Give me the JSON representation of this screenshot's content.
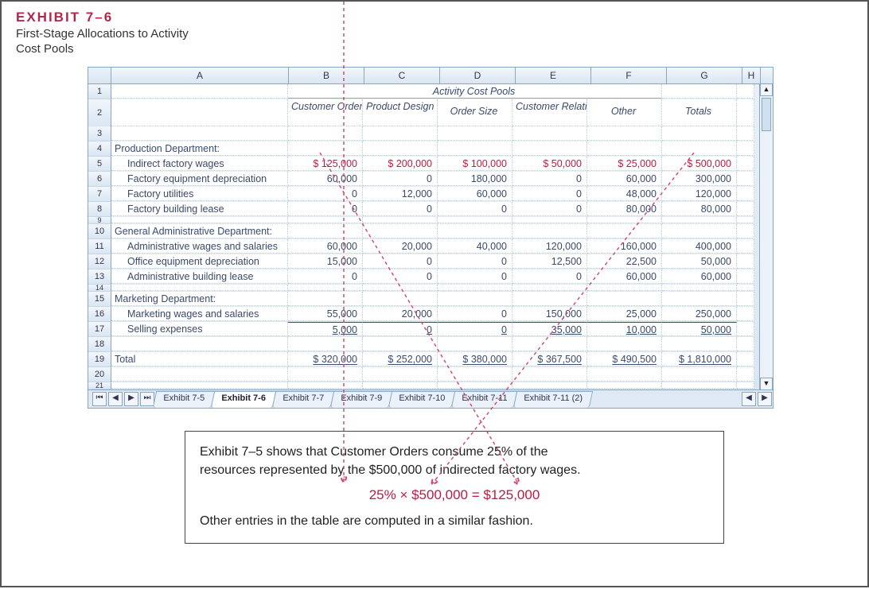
{
  "exhibit": {
    "number": "EXHIBIT 7–6",
    "title_line1": "First-Stage Allocations to Activity",
    "title_line2": "Cost Pools"
  },
  "columns": {
    "A": "A",
    "B": "B",
    "C": "C",
    "D": "D",
    "E": "E",
    "F": "F",
    "G": "G",
    "H": "H"
  },
  "header_row1_title": "Activity Cost Pools",
  "header_row2": {
    "B": "Customer Orders",
    "C": "Product Design",
    "D": "Order Size",
    "E": "Customer Relations",
    "F": "Other",
    "G": "Totals"
  },
  "sections": {
    "prod": "Production Department:",
    "admin": "General Administrative Department:",
    "mkt": "Marketing Department:",
    "total": "Total"
  },
  "rows": {
    "r5": {
      "label": "Indirect factory wages",
      "B": "$ 125,000",
      "C": "$ 200,000",
      "D": "$ 100,000",
      "E": "$   50,000",
      "F": "$   25,000",
      "G": "$    500,000"
    },
    "r6": {
      "label": "Factory equipment depreciation",
      "B": "60,000",
      "C": "0",
      "D": "180,000",
      "E": "0",
      "F": "60,000",
      "G": "300,000"
    },
    "r7": {
      "label": "Factory utilities",
      "B": "0",
      "C": "12,000",
      "D": "60,000",
      "E": "0",
      "F": "48,000",
      "G": "120,000"
    },
    "r8": {
      "label": "Factory building lease",
      "B": "0",
      "C": "0",
      "D": "0",
      "E": "0",
      "F": "80,000",
      "G": "80,000"
    },
    "r11": {
      "label": "Administrative wages and salaries",
      "B": "60,000",
      "C": "20,000",
      "D": "40,000",
      "E": "120,000",
      "F": "160,000",
      "G": "400,000"
    },
    "r12": {
      "label": "Office equipment depreciation",
      "B": "15,000",
      "C": "0",
      "D": "0",
      "E": "12,500",
      "F": "22,500",
      "G": "50,000"
    },
    "r13": {
      "label": "Administrative building lease",
      "B": "0",
      "C": "0",
      "D": "0",
      "E": "0",
      "F": "60,000",
      "G": "60,000"
    },
    "r16": {
      "label": "Marketing wages and salaries",
      "B": "55,000",
      "C": "20,000",
      "D": "0",
      "E": "150,000",
      "F": "25,000",
      "G": "250,000"
    },
    "r17": {
      "label": "Selling expenses",
      "B": "5,000",
      "C": "0",
      "D": "0",
      "E": "35,000",
      "F": "10,000",
      "G": "50,000"
    },
    "r19": {
      "B": "$ 320,000",
      "C": "$ 252,000",
      "D": "$ 380,000",
      "E": "$ 367,500",
      "F": "$ 490,500",
      "G": "$ 1,810,000"
    }
  },
  "rownums": {
    "1": "1",
    "2": "2",
    "3": "3",
    "4": "4",
    "5": "5",
    "6": "6",
    "7": "7",
    "8": "8",
    "9": "9",
    "10": "10",
    "11": "11",
    "12": "12",
    "13": "13",
    "14": "14",
    "15": "15",
    "16": "16",
    "17": "17",
    "18": "18",
    "19": "19",
    "20": "20",
    "21": "21"
  },
  "tabs": {
    "nav_first": "⏮",
    "nav_prev": "◀",
    "nav_next": "▶",
    "nav_last": "⏭",
    "t1": "Exhibit 7-5",
    "t2": "Exhibit 7-6",
    "t3": "Exhibit 7-7",
    "t4": "Exhibit 7-9",
    "t5": "Exhibit 7-10",
    "t6": "Exhibit 7-11",
    "t7": "Exhibit 7-11 (2)",
    "scroll_left": "◀",
    "scroll_right": "▶"
  },
  "callout": {
    "p1a": "Exhibit 7–5 shows that Customer Orders consume 25% of the",
    "p1b": "resources represented by the $500,000 of indirected factory wages.",
    "formula": "25%  ×  $500,000  =  $125,000",
    "p2": "Other entries in the table are computed in a similar fashion."
  },
  "chart_data": {
    "type": "table",
    "title": "First-Stage Allocations to Activity Cost Pools",
    "columns": [
      "Customer Orders",
      "Product Design",
      "Order Size",
      "Customer Relations",
      "Other",
      "Totals"
    ],
    "rows": [
      {
        "section": "Production Department",
        "item": "Indirect factory wages",
        "values": [
          125000,
          200000,
          100000,
          50000,
          25000,
          500000
        ]
      },
      {
        "section": "Production Department",
        "item": "Factory equipment depreciation",
        "values": [
          60000,
          0,
          180000,
          0,
          60000,
          300000
        ]
      },
      {
        "section": "Production Department",
        "item": "Factory utilities",
        "values": [
          0,
          12000,
          60000,
          0,
          48000,
          120000
        ]
      },
      {
        "section": "Production Department",
        "item": "Factory building lease",
        "values": [
          0,
          0,
          0,
          0,
          80000,
          80000
        ]
      },
      {
        "section": "General Administrative Department",
        "item": "Administrative wages and salaries",
        "values": [
          60000,
          20000,
          40000,
          120000,
          160000,
          400000
        ]
      },
      {
        "section": "General Administrative Department",
        "item": "Office equipment depreciation",
        "values": [
          15000,
          0,
          0,
          12500,
          22500,
          50000
        ]
      },
      {
        "section": "General Administrative Department",
        "item": "Administrative building lease",
        "values": [
          0,
          0,
          0,
          0,
          60000,
          60000
        ]
      },
      {
        "section": "Marketing Department",
        "item": "Marketing wages and salaries",
        "values": [
          55000,
          20000,
          0,
          150000,
          25000,
          250000
        ]
      },
      {
        "section": "Marketing Department",
        "item": "Selling expenses",
        "values": [
          5000,
          0,
          0,
          35000,
          10000,
          50000
        ]
      },
      {
        "section": "Total",
        "item": "Total",
        "values": [
          320000,
          252000,
          380000,
          367500,
          490500,
          1810000
        ]
      }
    ]
  }
}
